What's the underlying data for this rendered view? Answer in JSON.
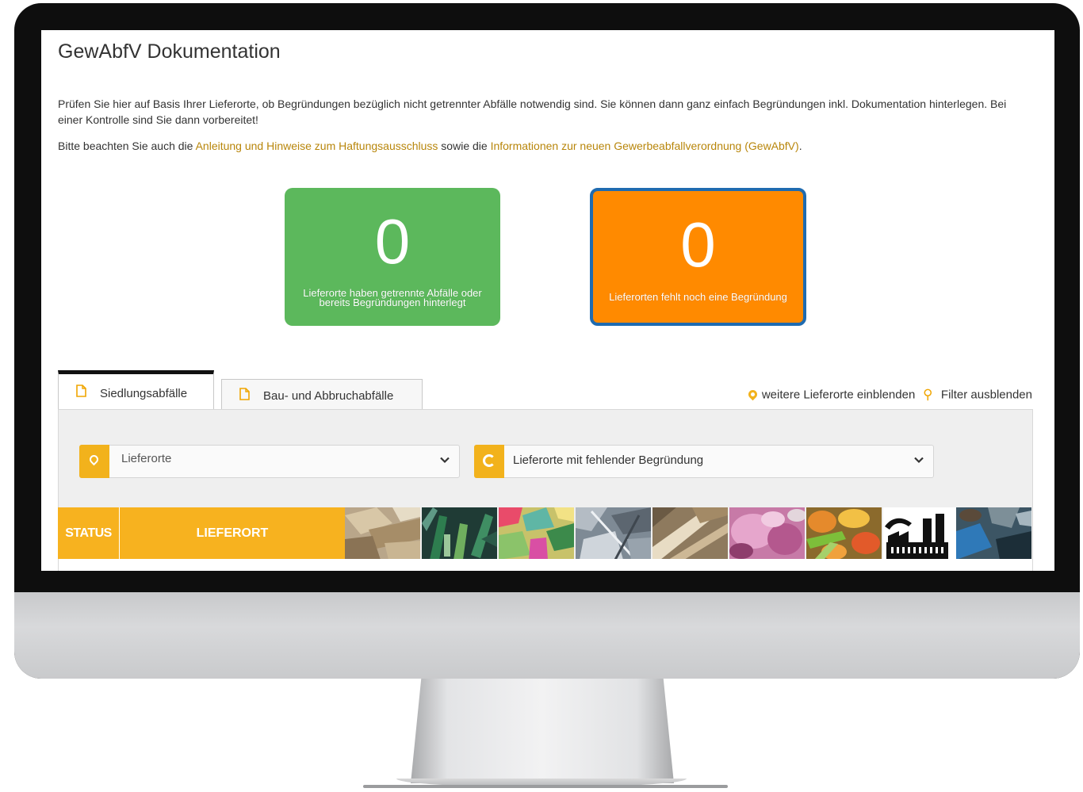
{
  "page": {
    "title": "GewAbfV Dokumentation",
    "intro": "Prüfen Sie hier auf Basis Ihrer Lieferorte, ob Begründungen bezüglich nicht getrennter Abfälle notwendig sind. Sie können dann ganz einfach Begründungen inkl. Dokumentation hinterlegen. Bei einer Kontrolle sind Sie dann vorbereitet!",
    "notice_prefix": "Bitte beachten Sie auch die ",
    "notice_link1": "Anleitung und Hinweise zum Haftungsausschluss",
    "notice_middle": " sowie die ",
    "notice_link2": "Informationen zur neuen Gewerbeabfallverordnung (GewAbfV)",
    "notice_suffix": "."
  },
  "tiles": [
    {
      "count": "0",
      "label": "Lieferorte haben getrennte Abfälle oder bereits Begründungen hinterlegt",
      "color": "#5cb85c"
    },
    {
      "count": "0",
      "label": "Lieferorten fehlt noch eine Begründung",
      "color": "#ff8a00"
    }
  ],
  "tabs": [
    {
      "label": "Siedlungsabfälle",
      "active": true,
      "icon": "document-icon"
    },
    {
      "label": "Bau- und Abbruchabfälle",
      "active": false,
      "icon": "document-icon"
    }
  ],
  "toolbar": {
    "show_more_label": "weitere Lieferorte einblenden",
    "hide_filter_label": "Filter ausblenden"
  },
  "filters": {
    "location": {
      "placeholder": "Lieferorte",
      "icon": "map-pin-icon"
    },
    "status": {
      "value": "Lieferorte mit fehlender Begründung",
      "icon": "refresh-icon"
    }
  },
  "table": {
    "columns": [
      "STATUS",
      "LIEFERORT"
    ],
    "waste_types": [
      "paper-cardboard",
      "glass",
      "plastics",
      "metals",
      "wood",
      "textiles",
      "biowaste",
      "commercial-waste",
      "mixed-waste"
    ]
  },
  "colors": {
    "accent": "#f7b21f",
    "link": "#b8860b",
    "active_border": "#1f6bb0"
  }
}
